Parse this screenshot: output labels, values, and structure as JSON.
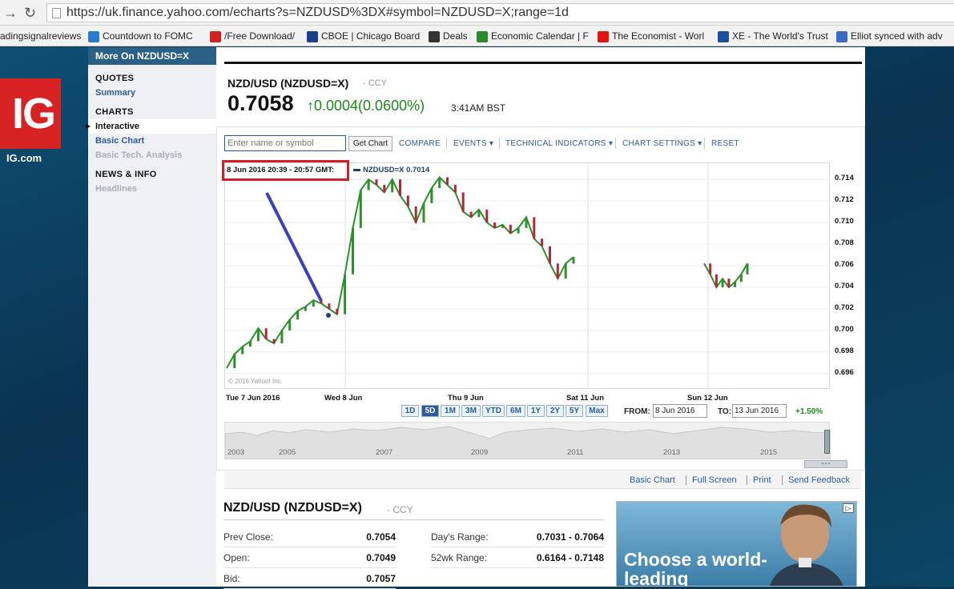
{
  "browser": {
    "url": "https://uk.finance.yahoo.com/echarts?s=NZDUSD%3DX#symbol=NZDUSD=X;range=1d",
    "bookmarks": [
      {
        "label": "adingsignalreviews",
        "icon_color": "#ffffff"
      },
      {
        "label": "Countdown to FOMC",
        "icon_color": "#2a7bd1"
      },
      {
        "label": "/Free Download/",
        "icon_color": "#d02020"
      },
      {
        "label": "CBOE | Chicago Board",
        "icon_color": "#1c3f8a"
      },
      {
        "label": "Deals",
        "icon_color": "#333333"
      },
      {
        "label": "Economic Calendar | F",
        "icon_color": "#2a8a2a"
      },
      {
        "label": "The Economist - Worl",
        "icon_color": "#e3120b"
      },
      {
        "label": "XE - The World's Trust",
        "icon_color": "#1c4f9c"
      },
      {
        "label": "Elliot synced with adv",
        "icon_color": "#3a6bc9"
      }
    ]
  },
  "brand": {
    "logo_text": "IG",
    "label": "IG.com"
  },
  "sidebar": {
    "header": "More On NZDUSD=X",
    "sections": [
      {
        "title": "QUOTES",
        "items": [
          {
            "label": "Summary",
            "state": "link"
          }
        ]
      },
      {
        "title": "CHARTS",
        "items": [
          {
            "label": "Interactive",
            "state": "active"
          },
          {
            "label": "Basic Chart",
            "state": "link"
          },
          {
            "label": "Basic Tech. Analysis",
            "state": "muted"
          }
        ]
      },
      {
        "title": "NEWS & INFO",
        "items": [
          {
            "label": "Headlines",
            "state": "muted"
          }
        ]
      }
    ]
  },
  "quote": {
    "title": "NZD/USD (NZDUSD=X)",
    "ccy": "- CCY",
    "price": "0.7058",
    "change": "↑0.0004(0.0600%)",
    "time": "3:41AM BST"
  },
  "toolbar": {
    "search_placeholder": "Enter name or symbol",
    "get_chart": "Get Chart",
    "compare": "COMPARE",
    "events": "EVENTS ▾",
    "technical": "TECHNICAL INDICATORS ▾",
    "settings": "CHART SETTINGS ▾",
    "reset": "RESET"
  },
  "hover": {
    "label": "8 Jun 2016 20:39 - 20:57 GMT:",
    "value": "NZDUSD=X 0.7014"
  },
  "copyright": "© 2016 Yahoo! Inc.",
  "ranges": [
    "1D",
    "5D",
    "1M",
    "3M",
    "YTD",
    "6M",
    "1Y",
    "2Y",
    "5Y",
    "Max"
  ],
  "selected_range": "5D",
  "dates": {
    "from_label": "FROM:",
    "from": "8 Jun 2016",
    "to_label": "TO:",
    "to": "13 Jun 2016",
    "change": "+1.50%"
  },
  "overview_years": [
    "2003",
    "2005",
    "2007",
    "2009",
    "2011",
    "2013",
    "2015"
  ],
  "links": [
    "Basic Chart",
    "Full Screen",
    "Print",
    "Send Feedback"
  ],
  "summary": {
    "title": "NZD/USD (NZDUSD=X)",
    "ccy": "- CCY",
    "left": [
      {
        "k": "Prev Close:",
        "v": "0.7054"
      },
      {
        "k": "Open:",
        "v": "0.7049"
      },
      {
        "k": "Bid:",
        "v": "0.7057"
      }
    ],
    "right": [
      {
        "k": "Day's Range:",
        "v": "0.7031 - 0.7064"
      },
      {
        "k": "52wk Range:",
        "v": "0.6164 - 0.7148"
      }
    ]
  },
  "ad": {
    "text": "Choose a world-leading"
  },
  "chart_data": {
    "type": "line",
    "x_labels": [
      "Tue 7 Jun 2016",
      "Wed 8 Jun",
      "Thu 9 Jun",
      "Sat 11 Jun",
      "Sun 12 Jun"
    ],
    "y_ticks": [
      "0.714",
      "0.712",
      "0.710",
      "0.708",
      "0.706",
      "0.704",
      "0.702",
      "0.700",
      "0.698",
      "0.696"
    ],
    "ylim": [
      0.6945,
      0.7155
    ],
    "grid": true,
    "series": [
      {
        "values_segment1": [
          0.6965,
          0.6978,
          0.6985,
          0.699,
          0.7002,
          0.6992,
          0.6988,
          0.7,
          0.701,
          0.7018,
          0.7022,
          0.7028,
          0.7025,
          0.702,
          0.7015,
          0.7052,
          0.7095,
          0.713,
          0.714,
          0.7135,
          0.7128,
          0.714,
          0.7125,
          0.7115,
          0.71,
          0.7118,
          0.7132,
          0.7142,
          0.7135,
          0.7128,
          0.711,
          0.7105,
          0.7112,
          0.71,
          0.7095,
          0.7098,
          0.709,
          0.7095,
          0.7105,
          0.7085,
          0.7078,
          0.7062,
          0.7048,
          0.7062,
          0.7068
        ],
        "values_segment2": [
          0.7062,
          0.7052,
          0.704,
          0.7048,
          0.704,
          0.7045,
          0.7052,
          0.7062
        ]
      }
    ],
    "annotation": {
      "type": "arrow-line",
      "color": "#3a3fc4",
      "marker_value": 0.7014
    }
  }
}
